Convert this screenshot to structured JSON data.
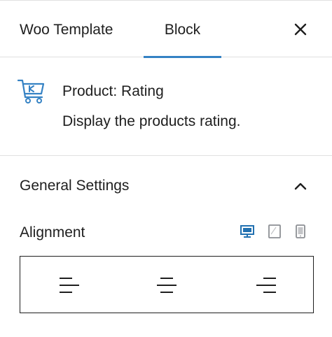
{
  "tabs": [
    {
      "label": "Woo Template"
    },
    {
      "label": "Block",
      "active": true
    }
  ],
  "close_icon": "close-icon",
  "block": {
    "icon": "cart-icon",
    "title": "Product: Rating",
    "description": "Display the products rating."
  },
  "panel": {
    "title": "General Settings",
    "expanded": true,
    "toggle_icon": "chevron-up-icon"
  },
  "alignment": {
    "label": "Alignment",
    "devices": [
      {
        "icon": "desktop-icon",
        "active": true
      },
      {
        "icon": "tablet-icon",
        "active": false
      },
      {
        "icon": "mobile-icon",
        "active": false
      }
    ],
    "options": [
      {
        "icon": "align-left-icon"
      },
      {
        "icon": "align-center-icon"
      },
      {
        "icon": "align-right-icon"
      }
    ]
  },
  "colors": {
    "accent": "#3582c4",
    "device_active": "#2271b1",
    "icon_muted": "#8c8f94",
    "text": "#1e1e1e",
    "divider": "#e0e0e0"
  }
}
